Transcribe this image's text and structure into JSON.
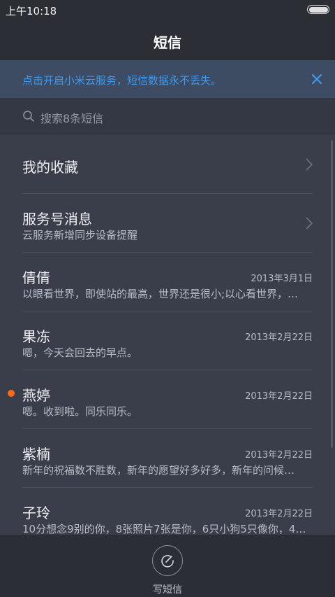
{
  "status": {
    "time": "上午10:18"
  },
  "header": {
    "title": "短信"
  },
  "banner": {
    "text": "点击开启小米云服务，短信数据永不丢失。"
  },
  "search": {
    "placeholder": "搜索8条短信"
  },
  "colors": {
    "accent_blue": "#3d9bf0",
    "unread_dot": "#ff6a1a"
  },
  "rows": [
    {
      "name": "我的收藏",
      "sub": "",
      "date": "",
      "chevron": true,
      "unread": false
    },
    {
      "name": "服务号消息",
      "sub": "云服务新增同步设备提醒",
      "date": "",
      "chevron": true,
      "unread": false
    },
    {
      "name": "倩倩",
      "sub": "以眼看世界，即使站的最高，世界还是很小;以心看世界，…",
      "date": "2013年3月1日",
      "chevron": false,
      "unread": false
    },
    {
      "name": "果冻",
      "sub": "嗯，今天会回去的早点。",
      "date": "2013年2月22日",
      "chevron": false,
      "unread": false
    },
    {
      "name": "燕婷",
      "sub": "嗯。收到啦。同乐同乐。",
      "date": "2013年2月22日",
      "chevron": false,
      "unread": true
    },
    {
      "name": "紫楠",
      "sub": "新年的祝福数不胜数，新年的愿望好多好多，新年的问候…",
      "date": "2013年2月22日",
      "chevron": false,
      "unread": false
    },
    {
      "name": "子玲",
      "sub": "10分想念9别的你，8张照片7张是你，6只小狗5只像你，4…",
      "date": "2013年2月22日",
      "chevron": false,
      "unread": false
    }
  ],
  "bottom": {
    "compose_label": "写短信"
  }
}
